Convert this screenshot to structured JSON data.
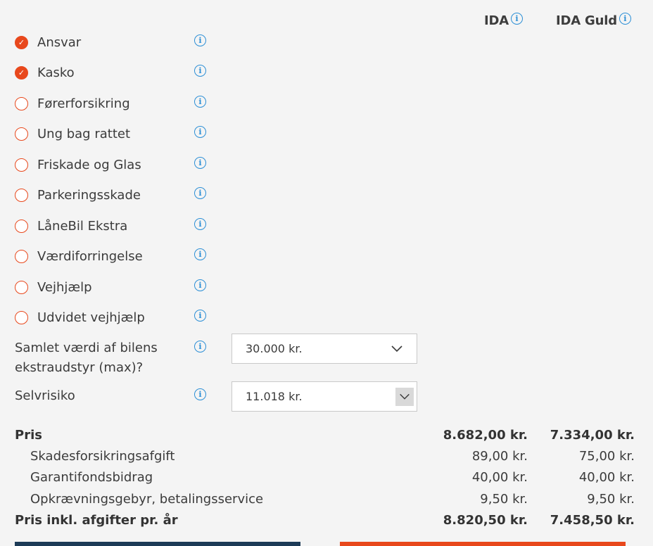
{
  "plans": [
    {
      "name": "IDA"
    },
    {
      "name": "IDA Guld"
    }
  ],
  "coverages": [
    {
      "label": "Ansvar",
      "checked": true
    },
    {
      "label": "Kasko",
      "checked": true
    },
    {
      "label": "Førerforsikring",
      "checked": false
    },
    {
      "label": "Ung bag rattet",
      "checked": false
    },
    {
      "label": "Friskade og Glas",
      "checked": false
    },
    {
      "label": "Parkeringsskade",
      "checked": false
    },
    {
      "label": "LåneBil Ekstra",
      "checked": false
    },
    {
      "label": "Værdiforringelse",
      "checked": false
    },
    {
      "label": "Vejhjælp",
      "checked": false
    },
    {
      "label": "Udvidet vejhjælp",
      "checked": false
    }
  ],
  "equipment": {
    "label_line1": "Samlet værdi af bilens",
    "label_line2": "ekstraudstyr (max)?",
    "value": "30.000 kr."
  },
  "deductible": {
    "label": "Selvrisiko",
    "value": "11.018 kr."
  },
  "pricing": [
    {
      "label": "Pris",
      "ida": "8.682,00 kr.",
      "guld": "7.334,00 kr.",
      "bold": true
    },
    {
      "label": "Skadesforsikringsafgift",
      "ida": "89,00 kr.",
      "guld": "75,00 kr.",
      "bold": false
    },
    {
      "label": "Garantifondsbidrag",
      "ida": "40,00 kr.",
      "guld": "40,00 kr.",
      "bold": false
    },
    {
      "label": "Opkrævningsgebyr, betalingsservice",
      "ida": "9,50 kr.",
      "guld": "9,50 kr.",
      "bold": false
    },
    {
      "label": "Pris inkl. afgifter pr. år",
      "ida": "8.820,50 kr.",
      "guld": "7.458,50 kr.",
      "bold": true
    }
  ],
  "icons": {
    "info": "i",
    "check": "✓"
  },
  "colors": {
    "accent": "#e8481c",
    "info": "#2c8fd6",
    "navy": "#1d3b57"
  }
}
